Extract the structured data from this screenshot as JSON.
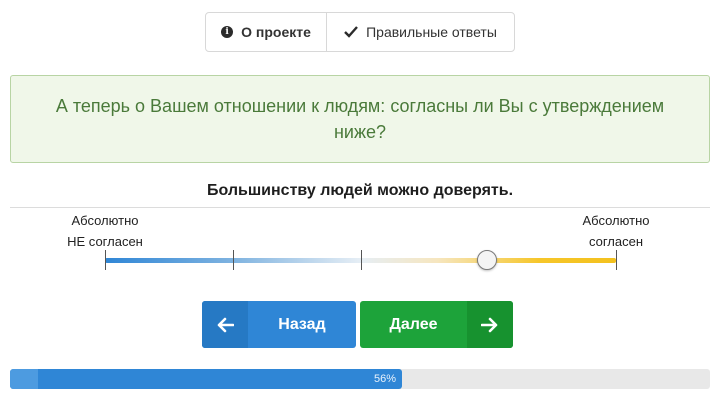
{
  "toolbar": {
    "about_label": "О проекте",
    "about_icon": "info-icon",
    "answers_label": "Правильные ответы",
    "answers_icon": "checkmark-icon"
  },
  "question": {
    "text": "А теперь о Вашем отношении к людям: согласны ли Вы с утверждением ниже?"
  },
  "statement": "Большинству людей можно доверять.",
  "scale": {
    "left_label_line1": "Абсолютно",
    "left_label_line2": "НЕ согласен",
    "right_label_line1": "Абсолютно",
    "right_label_line2": "согласен",
    "value": 0.75,
    "colors": {
      "negative": "#2f86d6",
      "neutral": "#e6eef5",
      "positive": "#f3c11e"
    }
  },
  "navigation": {
    "back_label": "Назад",
    "next_label": "Далее",
    "back_color": "#2f86d6",
    "next_color": "#1da33a"
  },
  "progress": {
    "percent": 56,
    "label": "56%",
    "color": "#2f86d6"
  }
}
